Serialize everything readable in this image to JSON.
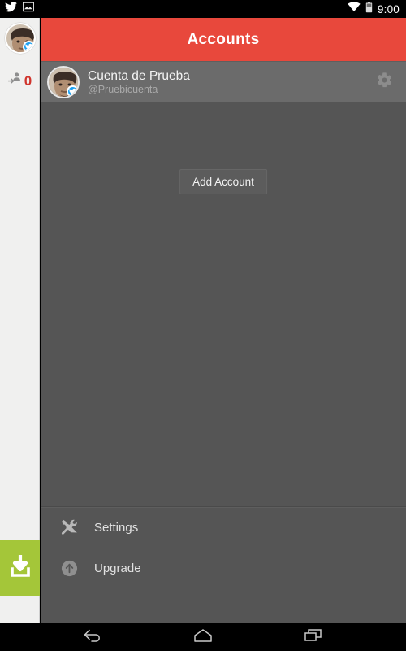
{
  "statusbar": {
    "time": "9:00",
    "left_icons": [
      "twitter-icon",
      "screenshot-image-icon"
    ],
    "right_icons": [
      "wifi-icon",
      "battery-icon"
    ]
  },
  "sidebar": {
    "avatar": {
      "name": "user-avatar",
      "badge": "twitter-badge"
    },
    "stat": {
      "icon": "mention-person-icon",
      "count": "0",
      "count_color": "#d0342c"
    },
    "download_tile": {
      "icon": "download-icon",
      "color": "#a4c639"
    }
  },
  "appbar": {
    "title": "Accounts",
    "color": "#e8483c"
  },
  "account": {
    "display_name": "Cuenta de Prueba",
    "handle": "@Pruebicuenta",
    "settings_icon": "gear-icon"
  },
  "main": {
    "add_account_label": "Add Account"
  },
  "bottom_menu": {
    "items": [
      {
        "label": "Settings",
        "icon": "tools-icon"
      },
      {
        "label": "Upgrade",
        "icon": "upgrade-arrow-icon"
      }
    ]
  },
  "navbar": {
    "buttons": [
      {
        "name": "back-button",
        "icon": "back-arrow-icon"
      },
      {
        "name": "home-button",
        "icon": "home-icon"
      },
      {
        "name": "recents-button",
        "icon": "recents-icon"
      }
    ]
  }
}
